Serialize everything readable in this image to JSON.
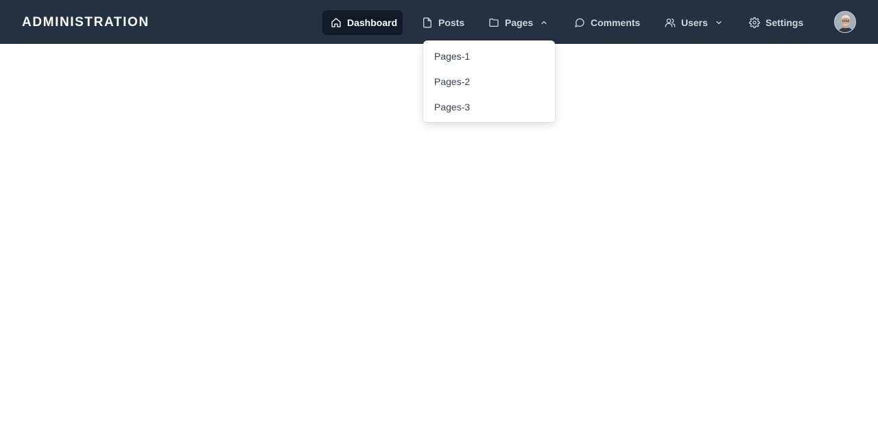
{
  "brand": {
    "title": "ADMINISTRATION"
  },
  "nav": {
    "dashboard": {
      "label": "Dashboard",
      "icon": "home-icon"
    },
    "posts": {
      "label": "Posts",
      "icon": "file-icon"
    },
    "pages": {
      "label": "Pages",
      "icon": "folder-icon",
      "expanded": true
    },
    "comments": {
      "label": "Comments",
      "icon": "message-circle-icon"
    },
    "users": {
      "label": "Users",
      "icon": "users-icon"
    },
    "settings": {
      "label": "Settings",
      "icon": "gear-icon"
    }
  },
  "pages_menu": {
    "items": [
      {
        "label": "Pages-1"
      },
      {
        "label": "Pages-2"
      },
      {
        "label": "Pages-3"
      }
    ]
  },
  "colors": {
    "navbar_bg": "#253041",
    "active_item_bg": "#131a27",
    "nav_text": "#d1d5db",
    "page_bg": "#ffffff"
  }
}
